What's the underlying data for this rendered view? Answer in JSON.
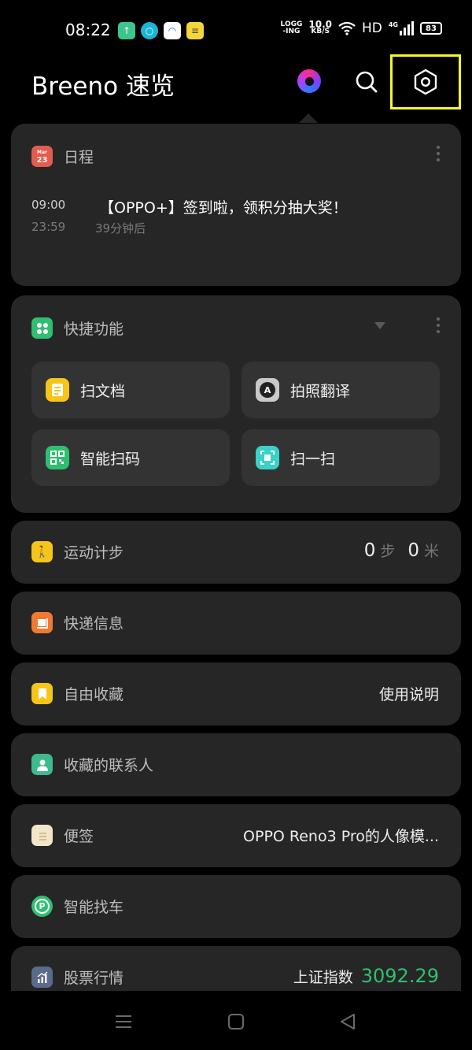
{
  "status_bar": {
    "time": "08:22",
    "net_speed_top": "LOGG",
    "net_speed_bottom": "-ING",
    "speed_value": "10.0",
    "speed_unit": "KB/S",
    "hd": "HD",
    "network": "4G",
    "battery": "83"
  },
  "header": {
    "title": "Breeno 速览"
  },
  "schedule": {
    "title": "日程",
    "icon_day": "23",
    "start_time": "09:00",
    "end_time": "23:59",
    "event_title": "【OPPO+】签到啦，领积分抽大奖！",
    "event_subtitle": "39分钟后"
  },
  "quick": {
    "title": "快捷功能",
    "tiles": [
      {
        "label": "扫文档"
      },
      {
        "label": "拍照翻译"
      },
      {
        "label": "智能扫码"
      },
      {
        "label": "扫一扫"
      }
    ]
  },
  "steps": {
    "title": "运动计步",
    "steps_value": "0",
    "steps_unit": "步",
    "distance_value": "0",
    "distance_unit": "米"
  },
  "express": {
    "title": "快递信息"
  },
  "favorites": {
    "title": "自由收藏",
    "action": "使用说明"
  },
  "contacts": {
    "title": "收藏的联系人"
  },
  "notes": {
    "title": "便签",
    "preview": "OPPO Reno3 Pro的人像模..."
  },
  "parking": {
    "title": "智能找车"
  },
  "stocks": {
    "title": "股票行情",
    "index_name": "上证指数",
    "index_value": "3092.29"
  },
  "colors": {
    "accent_yellow_highlight": "#f7f72a",
    "stock_green": "#2fbf71",
    "card_bg": "#262626"
  }
}
